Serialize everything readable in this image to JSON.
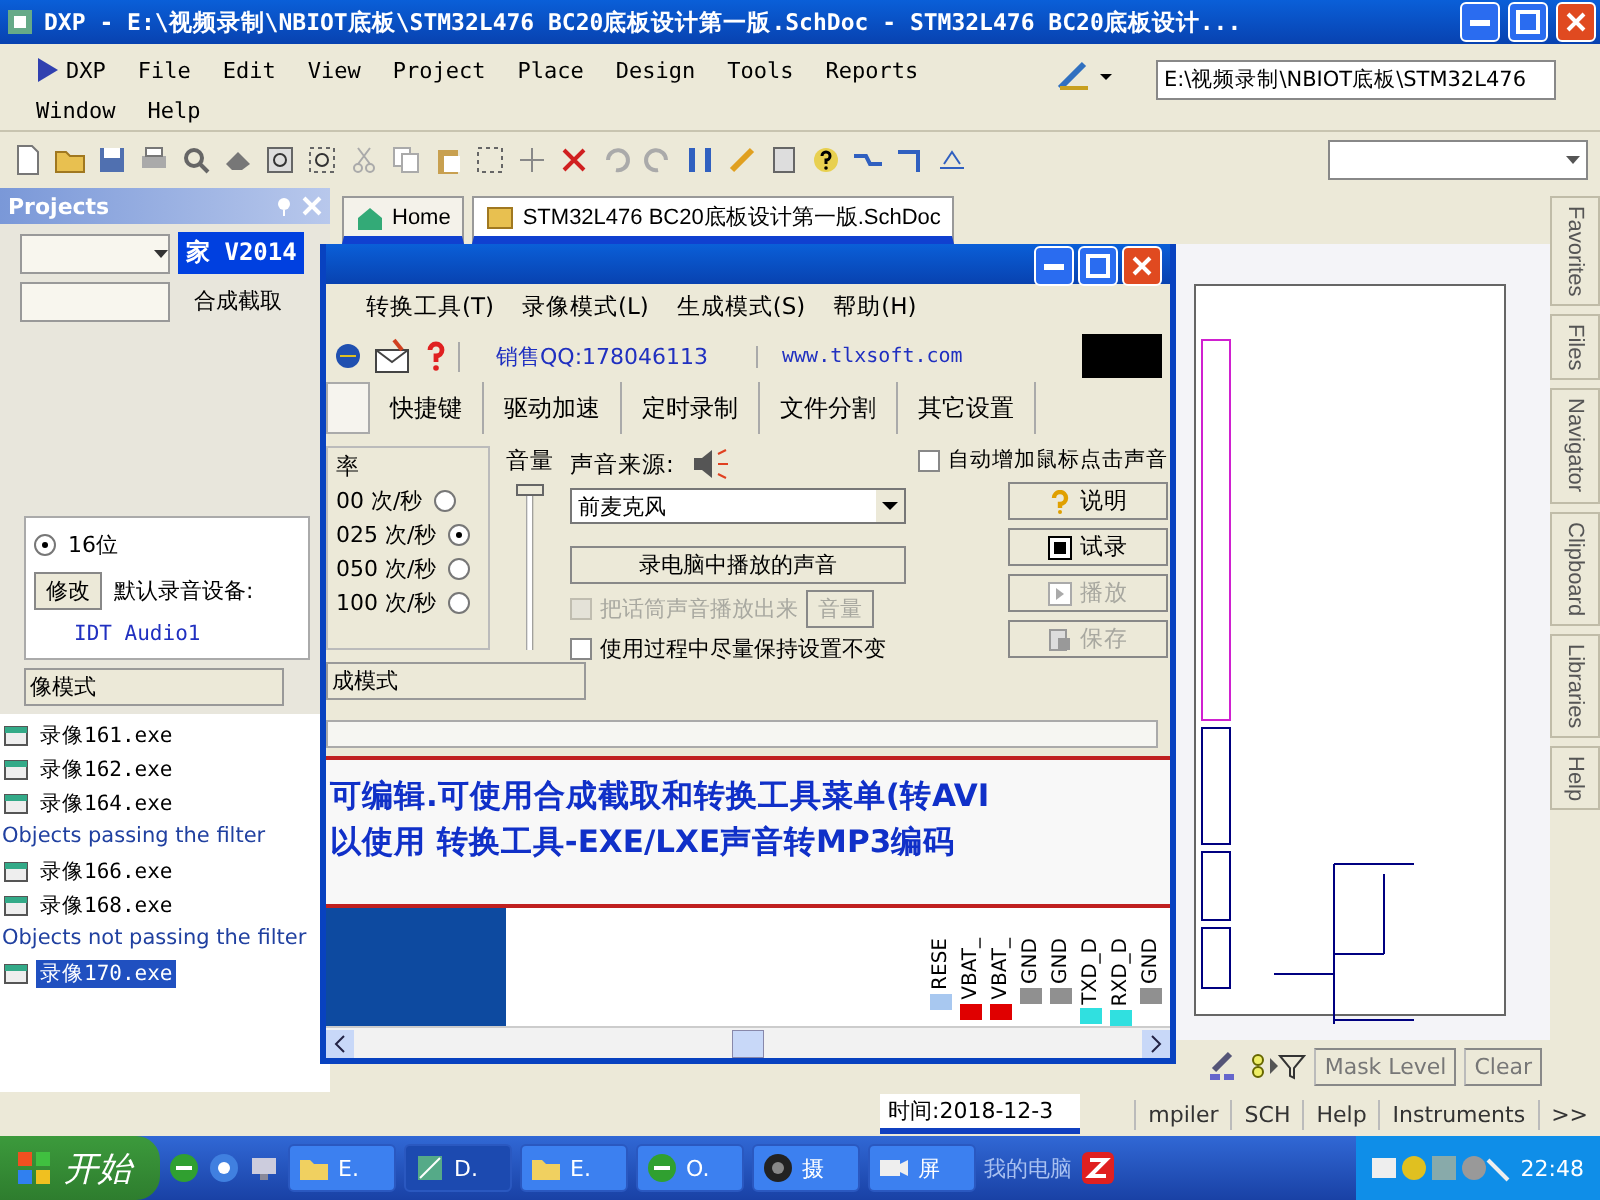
{
  "window": {
    "title": "DXP - E:\\视频录制\\NBIOT底板\\STM32L476 BC20底板设计第一版.SchDoc - STM32L476 BC20底板设计..."
  },
  "menu": [
    "DXP",
    "File",
    "Edit",
    "View",
    "Project",
    "Place",
    "Design",
    "Tools",
    "Reports",
    "Window",
    "Help"
  ],
  "path_combo": {
    "value": "E:\\视频录制\\NBIOT底板\\STM32L476"
  },
  "projects_panel": {
    "title": "Projects"
  },
  "ghost_window": {
    "title": "家 V2014",
    "menu_item": "合成截取",
    "bit_depth": {
      "label": "16位",
      "selected": true
    },
    "modify_button": "修改",
    "device_label": "默认录音设备:",
    "device": "IDT Audio1",
    "mode_tab": "像模式"
  },
  "file_list": [
    {
      "kind": "file",
      "label": "录像161.exe",
      "selected": false
    },
    {
      "kind": "file",
      "label": "录像162.exe",
      "selected": false
    },
    {
      "kind": "file",
      "label": "录像164.exe",
      "selected": false
    },
    {
      "kind": "heading",
      "label": "Objects passing the filter"
    },
    {
      "kind": "file",
      "label": "录像166.exe",
      "selected": false
    },
    {
      "kind": "file",
      "label": "录像168.exe",
      "selected": false
    },
    {
      "kind": "heading",
      "label": "Objects not passing the filter"
    },
    {
      "kind": "file",
      "label": "录像170.exe",
      "selected": true
    }
  ],
  "doc_tabs": [
    {
      "label": "Home",
      "selected": false
    },
    {
      "label": "STM32L476 BC20底板设计第一版.SchDoc",
      "selected": true
    }
  ],
  "recorder": {
    "menu": [
      "转换工具(T)",
      "录像模式(L)",
      "生成模式(S)",
      "帮助(H)"
    ],
    "sales_qq": "销售QQ:178046113",
    "website": "www.tlxsoft.com",
    "tabs": [
      {
        "label": "快捷键",
        "selected": false
      },
      {
        "label": "驱动加速",
        "selected": false
      },
      {
        "label": "定时录制",
        "selected": false
      },
      {
        "label": "文件分割",
        "selected": false
      },
      {
        "label": "其它设置",
        "selected": false
      }
    ],
    "rate_title": "率",
    "rates": [
      {
        "label": "00 次/秒",
        "selected": false
      },
      {
        "label": "025 次/秒",
        "selected": true
      },
      {
        "label": "050 次/秒",
        "selected": false
      },
      {
        "label": "100 次/秒",
        "selected": false
      }
    ],
    "volume_label": "音量",
    "volume": {
      "level": 1
    },
    "source_label": "声音来源:",
    "source": "前麦克风",
    "auto_click": {
      "label": "自动增加鼠标点击声音",
      "checked": false
    },
    "record_playback_button": "录电脑中播放的声音",
    "options": [
      {
        "label": "把话筒声音播放出来",
        "checked": false,
        "disabled": true
      },
      {
        "label": "使用过程中尽量保持设置不变",
        "checked": false,
        "disabled": false
      }
    ],
    "volume_button": {
      "label": "音量",
      "disabled": true
    },
    "side_buttons": [
      {
        "kind": "help",
        "label": "说明",
        "disabled": false
      },
      {
        "kind": "record",
        "label": "试录",
        "disabled": false
      },
      {
        "kind": "play",
        "label": "播放",
        "disabled": true
      },
      {
        "kind": "save",
        "label": "保存",
        "disabled": true
      }
    ],
    "mode_tab": "成模式",
    "banner": [
      "可编辑.可使用合成截取和转换工具菜单(转AVI",
      "以使用 转换工具-EXE/LXE声音转MP3编码"
    ],
    "pins": [
      {
        "label": "RESE",
        "color": "#a8c8f0"
      },
      {
        "label": "VBAT_",
        "color": "#e00000"
      },
      {
        "label": "VBAT_",
        "color": "#e00000"
      },
      {
        "label": "GND",
        "color": "#909090"
      },
      {
        "label": "GND",
        "color": "#909090"
      },
      {
        "label": "TXD_D",
        "color": "#30e0e0"
      },
      {
        "label": "RXD_D",
        "color": "#30e0e0"
      },
      {
        "label": "GND",
        "color": "#909090"
      }
    ]
  },
  "side_tabs": [
    "Favorites",
    "Files",
    "Navigator",
    "Clipboard",
    "Libraries",
    "Help"
  ],
  "mask_level": "Mask Level",
  "clear": "Clear",
  "status": {
    "time": "时间:2018-12-3",
    "tabs": [
      "mpiler",
      "SCH",
      "Help",
      "Instruments"
    ],
    "more": ">>"
  },
  "taskbar": {
    "start": "开始",
    "tasks": [
      {
        "label": "E.",
        "kind": "folder",
        "selected": false
      },
      {
        "label": "D.",
        "kind": "app",
        "selected": true
      },
      {
        "label": "E.",
        "kind": "folder",
        "selected": false
      },
      {
        "label": "O.",
        "kind": "browser",
        "selected": false
      },
      {
        "label": "摄",
        "kind": "camera",
        "selected": false
      },
      {
        "label": "屏",
        "kind": "recorder",
        "selected": false
      }
    ],
    "toolbar_label": "我的电脑",
    "clock": "22:48"
  }
}
